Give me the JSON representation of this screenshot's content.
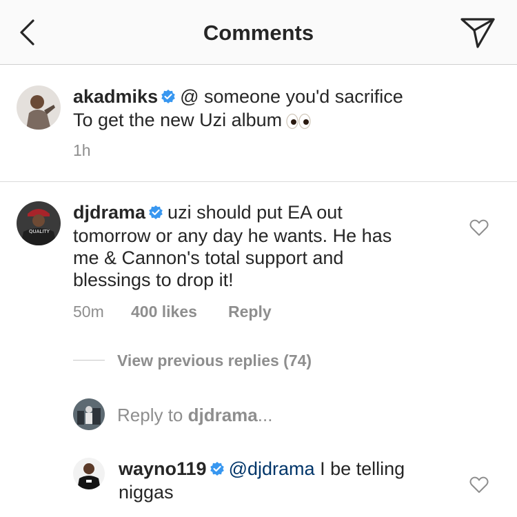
{
  "header": {
    "title": "Comments",
    "back_icon": "chevron-left-icon",
    "send_icon": "paper-plane-icon"
  },
  "caption": {
    "username": "akadmiks",
    "text_line1": "@ someone you'd sacrifice",
    "text_line2": "To get the new Uzi album",
    "emoji": "eyes",
    "time": "1h"
  },
  "comment": {
    "username": "djdrama",
    "lines": [
      "uzi should put EA out",
      "tomorrow or any day he wants. He has",
      "me & Cannon's total support and",
      "blessings to drop it!"
    ],
    "time": "50m",
    "likes": "400 likes",
    "reply_label": "Reply"
  },
  "view_replies": "View previous replies (74)",
  "reply_input": {
    "prefix": "Reply to ",
    "target": "djdrama",
    "suffix": "..."
  },
  "reply": {
    "username": "wayno119",
    "mention": "@djdrama",
    "text_line1_rest": "I be telling",
    "text_line2": "niggas"
  },
  "colors": {
    "verified": "#3897f0",
    "mention": "#003569",
    "muted": "#8e8e8e",
    "header_bg": "#fafafa"
  }
}
